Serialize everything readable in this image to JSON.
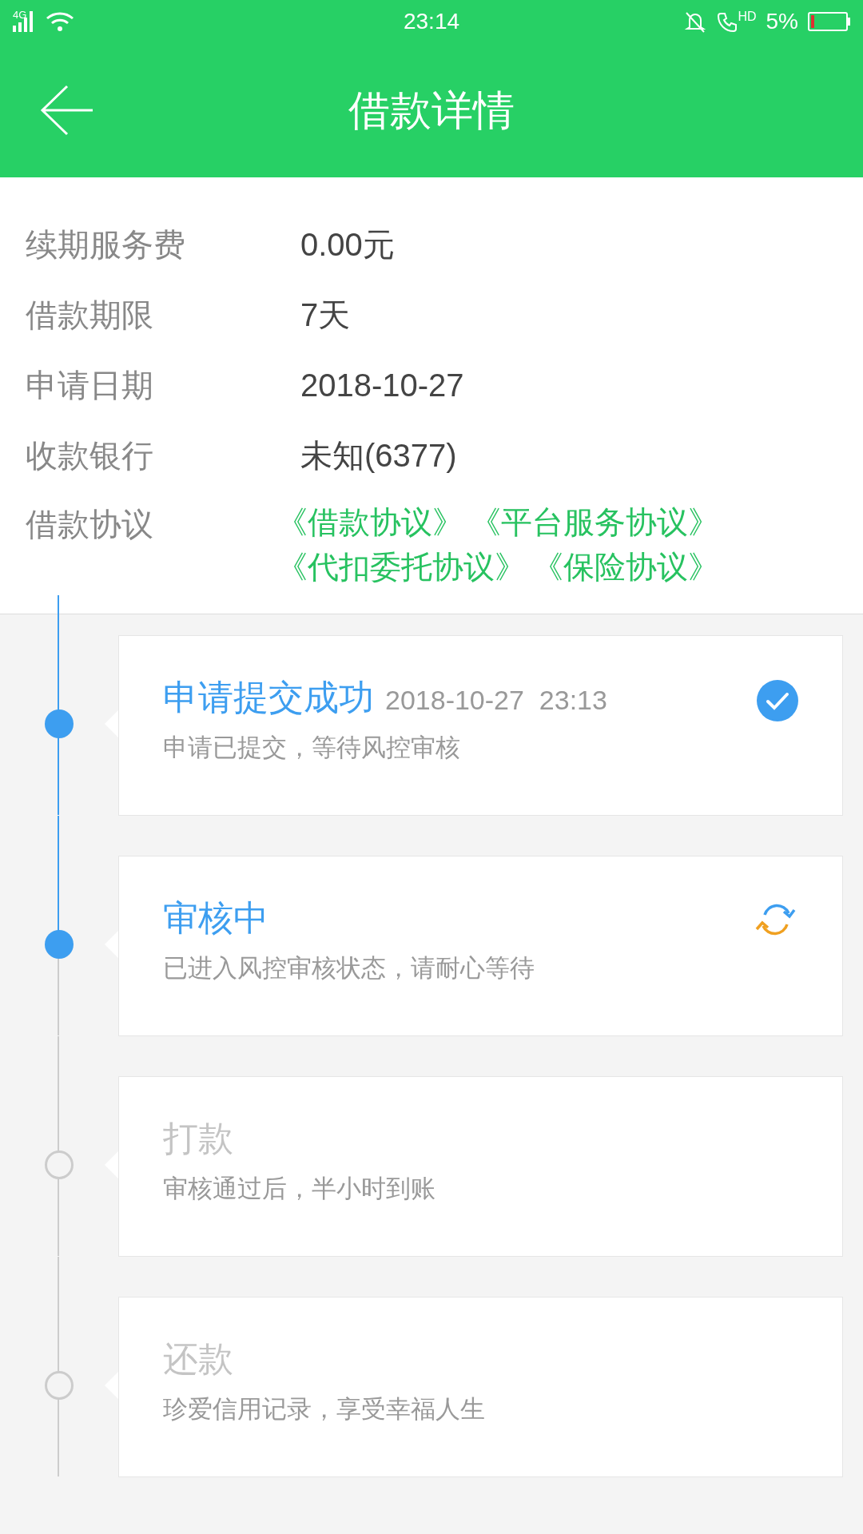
{
  "status_bar": {
    "network": "4G",
    "time": "23:14",
    "call_badge": "HD",
    "battery": "5%"
  },
  "header": {
    "title": "借款详情"
  },
  "details": [
    {
      "label": "续期服务费",
      "value": "0.00元"
    },
    {
      "label": "借款期限",
      "value": "7天"
    },
    {
      "label": "申请日期",
      "value": "2018-10-27"
    },
    {
      "label": "收款银行",
      "value": "未知(6377)"
    }
  ],
  "agreements": {
    "label": "借款协议",
    "links": [
      [
        "《借款协议》",
        "《平台服务协议》"
      ],
      [
        "《代扣委托协议》",
        "《保险协议》"
      ]
    ]
  },
  "steps": [
    {
      "title": "申请提交成功",
      "time": "2018-10-27  23:13",
      "description": "申请已提交，等待风控审核",
      "kind": "done"
    },
    {
      "title": "审核中",
      "description": "已进入风控审核状态，请耐心等待",
      "kind": "active"
    },
    {
      "title": "打款",
      "description": "审核通过后，半小时到账",
      "kind": "pending"
    },
    {
      "title": "还款",
      "description": "珍爱信用记录，享受幸福人生",
      "kind": "pending"
    }
  ]
}
